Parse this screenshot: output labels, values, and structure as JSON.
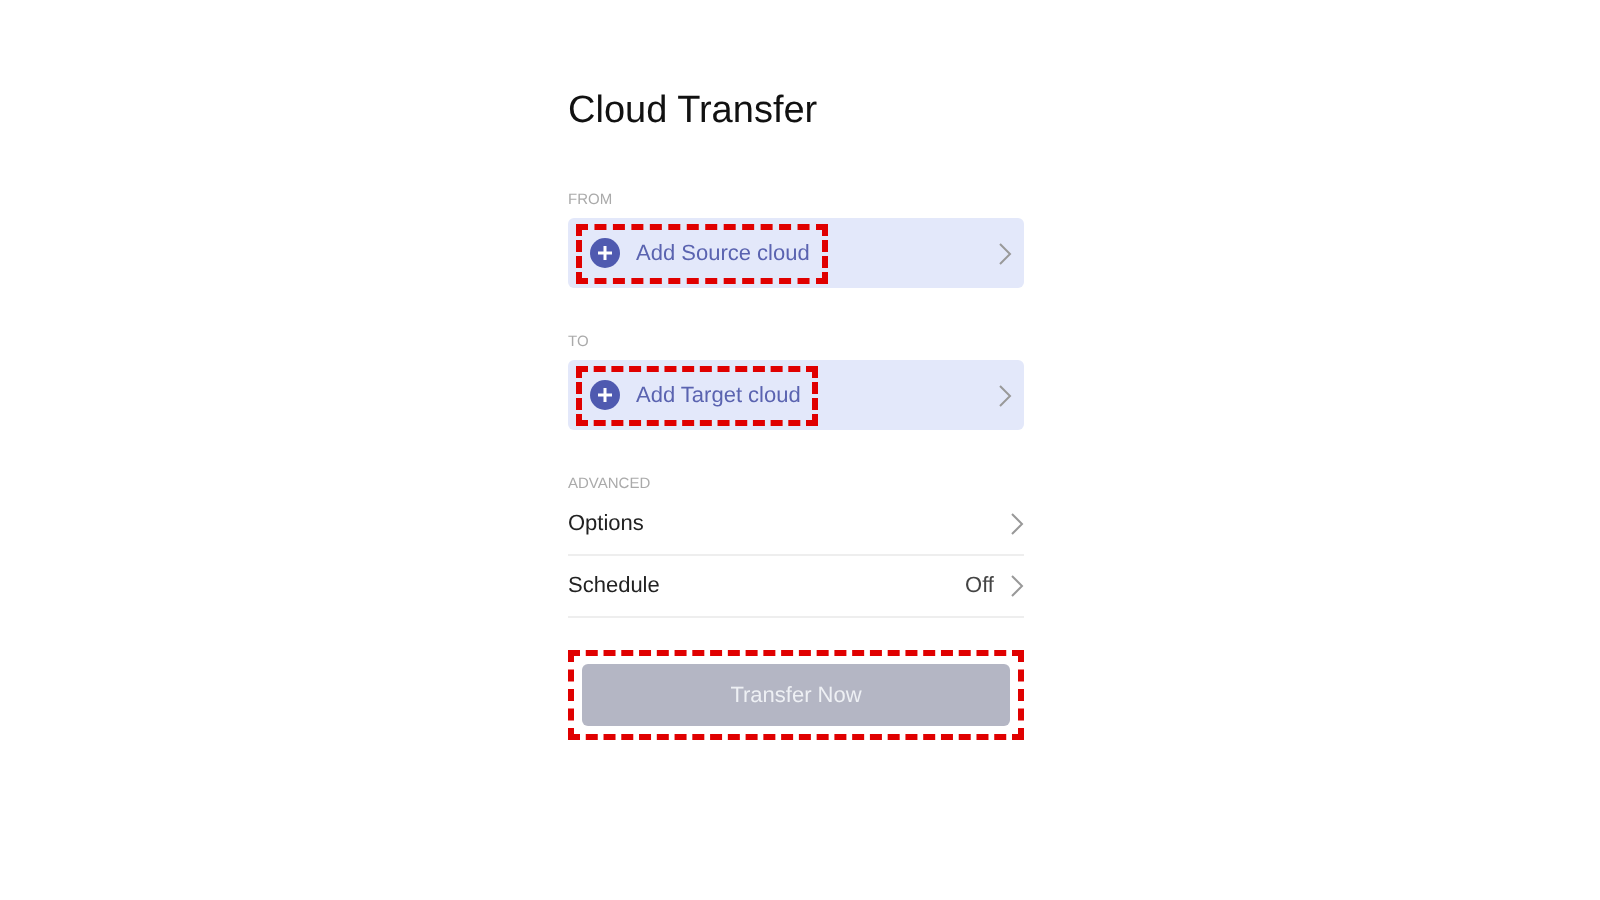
{
  "title": "Cloud Transfer",
  "from": {
    "label": "FROM",
    "action": "Add Source cloud",
    "highlighted": true
  },
  "to": {
    "label": "TO",
    "action": "Add Target cloud",
    "highlighted": true
  },
  "advanced": {
    "label": "ADVANCED",
    "rows": [
      {
        "label": "Options"
      },
      {
        "label": "Schedule",
        "value": "Off"
      }
    ]
  },
  "submit": {
    "label": "Transfer Now",
    "disabled": true,
    "highlighted": true
  }
}
